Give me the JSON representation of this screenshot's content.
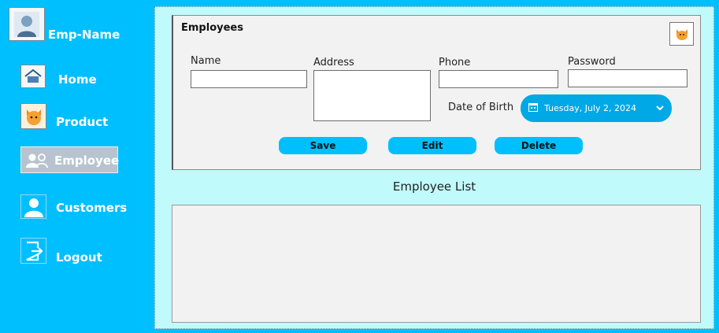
{
  "sidebar": {
    "brand": "Emp-Name",
    "items": [
      {
        "label": "Home"
      },
      {
        "label": "Product"
      },
      {
        "label": "Employee"
      },
      {
        "label": "Customers"
      },
      {
        "label": "Logout"
      }
    ]
  },
  "form": {
    "title": "Employees",
    "fields": {
      "name_label": "Name",
      "address_label": "Address",
      "phone_label": "Phone",
      "password_label": "Password",
      "dob_label": "Date of Birth"
    },
    "values": {
      "name": "",
      "address": "",
      "phone": "",
      "password": ""
    },
    "date_value": "Tuesday, July 2, 2024",
    "buttons": {
      "save": "Save",
      "edit": "Edit",
      "delete": "Delete"
    }
  },
  "list": {
    "title": "Employee List"
  },
  "colors": {
    "background": "#00BFFF",
    "panel": "#C1FAFB",
    "accent": "#00A8E6"
  }
}
